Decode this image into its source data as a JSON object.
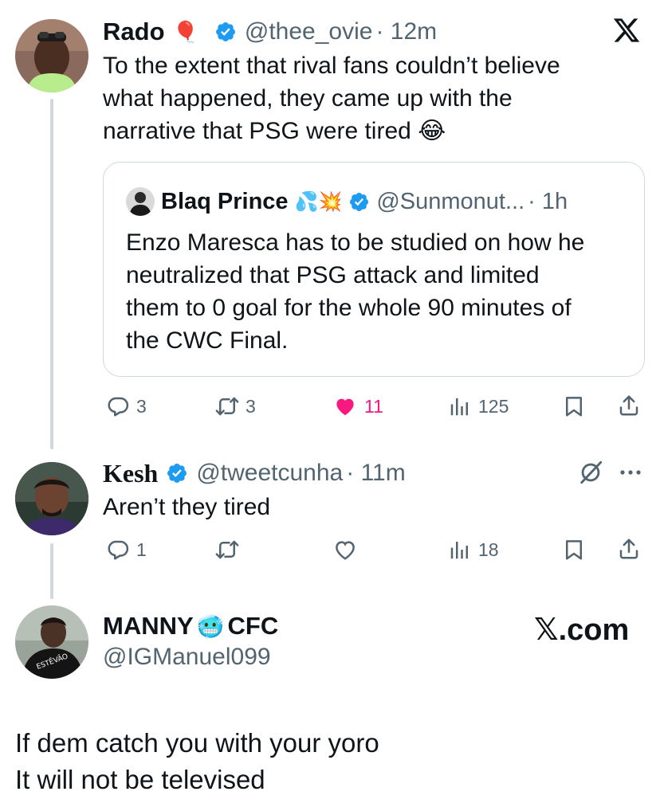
{
  "tweet1": {
    "name": "Rado",
    "handle": "@thee_ovie",
    "time": "· 12m",
    "text_lines": [
      "To the extent that rival fans couldn’t believe",
      "what happened, they came up with the",
      "narrative that PSG were tired"
    ],
    "emoji": "😂",
    "name_emoji": "🎈",
    "quote": {
      "name": "Blaq Prince",
      "name_emoji": "💦💥",
      "handle": "@Sunmonut...",
      "time": "· 1h",
      "text_lines": [
        "Enzo Maresca has to be studied on how he",
        "neutralized that PSG attack and limited",
        "them to 0 goal for the whole 90 minutes of",
        "the CWC Final."
      ]
    },
    "actions": {
      "replies": "3",
      "reposts": "3",
      "likes": "11",
      "views": "125"
    }
  },
  "tweet2": {
    "name": "Kesh",
    "handle": "@tweetcunha",
    "time": "· 11m",
    "text": "Aren’t they tired",
    "actions": {
      "replies": "1",
      "reposts": "",
      "likes": "",
      "views": "18"
    }
  },
  "tweet3": {
    "name_part1": "MANNY",
    "name_emoji": "🥶",
    "name_part2": "CFC",
    "handle": "@IGManuel099",
    "text_lines": [
      "If dem catch you with your yoro",
      "It will not be televised"
    ]
  },
  "branding": {
    "logo": "𝕏",
    "site": "𝕏.com"
  },
  "colors": {
    "accent": "#1d9bf0",
    "like": "#f91880",
    "secondary_text": "#536471",
    "border": "#cfd9de"
  },
  "icons": [
    "x-logo-icon",
    "verified-badge-icon",
    "reply-icon",
    "repost-icon",
    "like-icon",
    "views-icon",
    "bookmark-icon",
    "share-icon",
    "grok-icon",
    "more-icon"
  ]
}
